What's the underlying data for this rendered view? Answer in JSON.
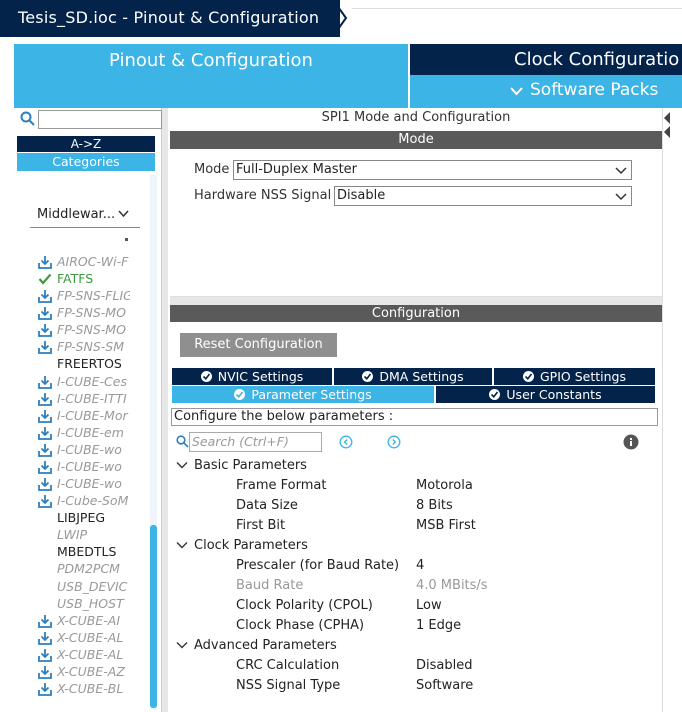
{
  "breadcrumb": {
    "file": "Tesis_SD.ioc - Pinout & Configuration"
  },
  "tabs": {
    "pinout": "Pinout & Configuration",
    "clock": "Clock Configuratio",
    "software_packs": "Software Packs"
  },
  "left": {
    "search_placeholder": "",
    "az_label": "A->Z",
    "categories_label": "Categories",
    "middleware_select": "Middlewar...",
    "items": [
      {
        "label": "AIROC-Wi-F",
        "state": "disabled",
        "icon": "download-icon"
      },
      {
        "label": "FATFS",
        "state": "green",
        "icon": "check-icon"
      },
      {
        "label": "FP-SNS-FLIG",
        "state": "disabled",
        "icon": "download-icon"
      },
      {
        "label": "FP-SNS-MO",
        "state": "disabled",
        "icon": "download-icon"
      },
      {
        "label": "FP-SNS-MO",
        "state": "disabled",
        "icon": "download-icon"
      },
      {
        "label": "FP-SNS-SM",
        "state": "disabled",
        "icon": "download-icon"
      },
      {
        "label": "FREERTOS",
        "state": "enabled",
        "icon": ""
      },
      {
        "label": "I-CUBE-Ces",
        "state": "disabled",
        "icon": "download-icon"
      },
      {
        "label": "I-CUBE-ITTI",
        "state": "disabled",
        "icon": "download-icon"
      },
      {
        "label": "I-CUBE-Mor",
        "state": "disabled",
        "icon": "download-icon"
      },
      {
        "label": "I-CUBE-em",
        "state": "disabled",
        "icon": "download-icon"
      },
      {
        "label": "I-CUBE-wo",
        "state": "disabled",
        "icon": "download-icon"
      },
      {
        "label": "I-CUBE-wo",
        "state": "disabled",
        "icon": "download-icon"
      },
      {
        "label": "I-CUBE-wo",
        "state": "disabled",
        "icon": "download-icon"
      },
      {
        "label": "I-Cube-SoM",
        "state": "disabled",
        "icon": "download-icon"
      },
      {
        "label": "LIBJPEG",
        "state": "enabled",
        "icon": ""
      },
      {
        "label": "LWIP",
        "state": "disabled",
        "icon": ""
      },
      {
        "label": "MBEDTLS",
        "state": "enabled",
        "icon": ""
      },
      {
        "label": "PDM2PCM",
        "state": "disabled",
        "icon": ""
      },
      {
        "label": "USB_DEVIC",
        "state": "disabled",
        "icon": ""
      },
      {
        "label": "USB_HOST",
        "state": "disabled",
        "icon": ""
      },
      {
        "label": "X-CUBE-AI",
        "state": "disabled",
        "icon": "download-icon"
      },
      {
        "label": "X-CUBE-AL",
        "state": "disabled",
        "icon": "download-icon"
      },
      {
        "label": "X-CUBE-AL",
        "state": "disabled",
        "icon": "download-icon"
      },
      {
        "label": "X-CUBE-AZ",
        "state": "disabled",
        "icon": "download-icon"
      },
      {
        "label": "X-CUBE-BL",
        "state": "disabled",
        "icon": "download-icon"
      }
    ]
  },
  "mode": {
    "title": "SPI1 Mode and Configuration",
    "section": "Mode",
    "mode_label": "Mode",
    "mode_value": "Full-Duplex Master",
    "nss_label": "Hardware NSS Signal",
    "nss_value": "Disable"
  },
  "config": {
    "section": "Configuration",
    "reset_label": "Reset Configuration",
    "tabs": [
      "NVIC Settings",
      "DMA Settings",
      "GPIO Settings",
      "Parameter Settings",
      "User Constants"
    ],
    "hint": "Configure the below parameters :",
    "search_placeholder": "Search (Ctrl+F)",
    "groups": [
      {
        "name": "Basic Parameters",
        "params": [
          {
            "name": "Frame Format",
            "value": "Motorola",
            "dim": false
          },
          {
            "name": "Data Size",
            "value": "8 Bits",
            "dim": false
          },
          {
            "name": "First Bit",
            "value": "MSB First",
            "dim": false
          }
        ]
      },
      {
        "name": "Clock Parameters",
        "params": [
          {
            "name": "Prescaler (for Baud Rate)",
            "value": "4",
            "dim": false
          },
          {
            "name": "Baud Rate",
            "value": "4.0 MBits/s",
            "dim": true
          },
          {
            "name": "Clock Polarity (CPOL)",
            "value": "Low",
            "dim": false
          },
          {
            "name": "Clock Phase (CPHA)",
            "value": "1 Edge",
            "dim": false
          }
        ]
      },
      {
        "name": "Advanced Parameters",
        "params": [
          {
            "name": "CRC Calculation",
            "value": "Disabled",
            "dim": false
          },
          {
            "name": "NSS Signal Type",
            "value": "Software",
            "dim": false
          }
        ]
      }
    ]
  },
  "colors": {
    "navy": "#03234b",
    "accent": "#3cb4e6",
    "header_gray": "#5a5a5a"
  }
}
